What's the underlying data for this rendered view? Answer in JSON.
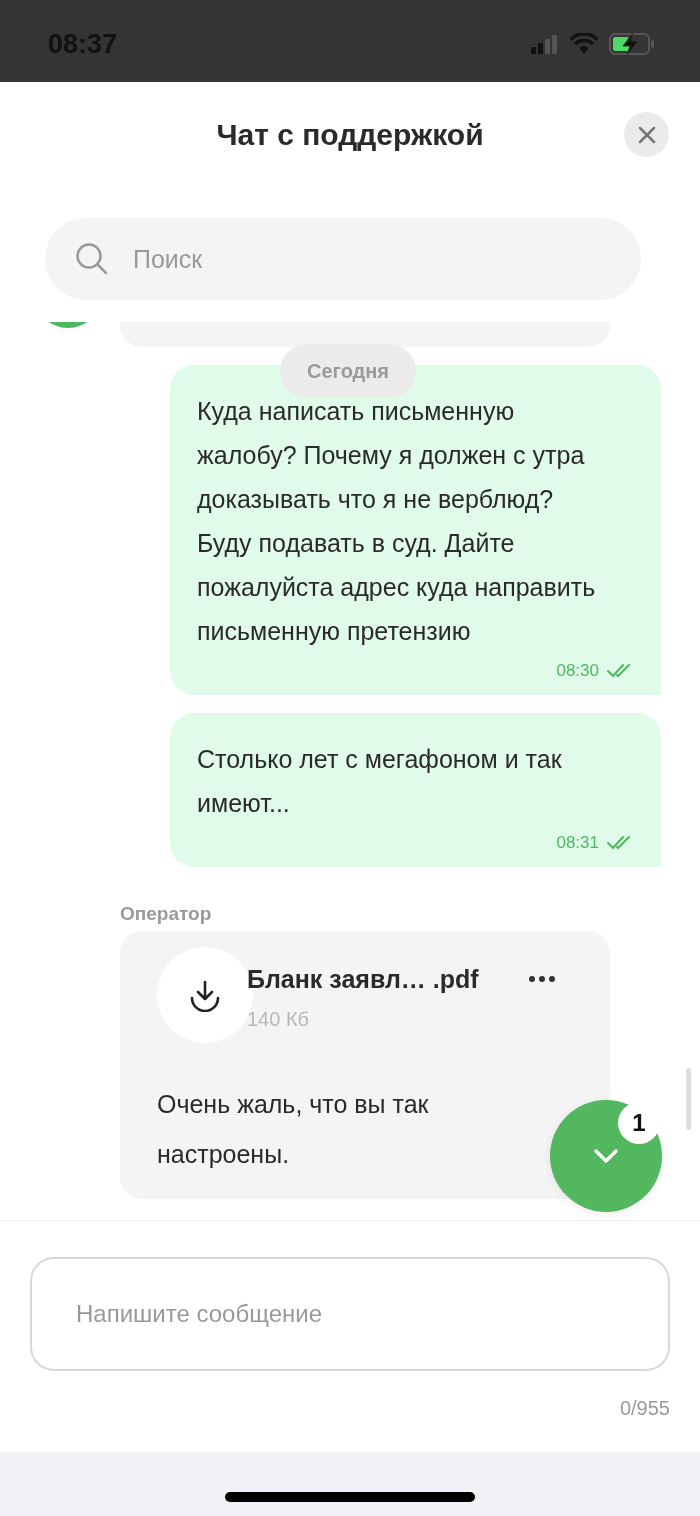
{
  "status_bar": {
    "time": "08:37"
  },
  "header": {
    "title": "Чат с поддержкой"
  },
  "search": {
    "placeholder": "Поиск"
  },
  "date_label": "Сегодня",
  "messages": [
    {
      "kind": "incoming_partial"
    },
    {
      "kind": "outgoing",
      "text": "Куда написать письменную жалобу? Почему я должен с утра доказывать что я не верблюд? Буду подавать в суд. Дайте пожалуйста адрес куда направить письменную претензию",
      "time": "08:30",
      "read": true
    },
    {
      "kind": "outgoing",
      "text": "Столько лет с мегафоном и так имеют...",
      "time": "08:31",
      "read": true
    },
    {
      "kind": "operator",
      "sender": "Оператор",
      "file": {
        "name": "Бланк заявл… .pdf",
        "size": "140 Кб"
      },
      "text": "Очень жаль, что вы так настроены."
    }
  ],
  "scroll_button": {
    "badge": "1"
  },
  "composer": {
    "placeholder": "Напишите сообщение",
    "counter": "0/955"
  }
}
